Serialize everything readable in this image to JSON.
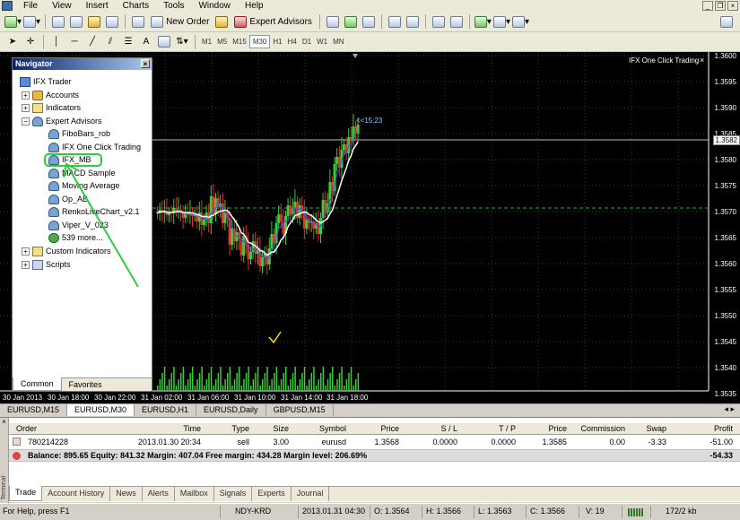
{
  "menu": {
    "items": [
      "File",
      "View",
      "Insert",
      "Charts",
      "Tools",
      "Window",
      "Help"
    ]
  },
  "toolbar": {
    "new_order_label": "New Order",
    "expert_advisors_label": "Expert Advisors",
    "timeframes": [
      "M1",
      "M5",
      "M15",
      "M30",
      "H1",
      "H4",
      "D1",
      "W1",
      "MN"
    ],
    "active_timeframe": "M30",
    "text_tool": "A"
  },
  "navigator": {
    "title": "Navigator",
    "root": "IFX Trader",
    "items": {
      "accounts": "Accounts",
      "indicators": "Indicators",
      "expert_advisors": "Expert Advisors",
      "custom_indicators": "Custom Indicators",
      "scripts": "Scripts"
    },
    "experts": [
      "FiboBars_rob",
      "IFX One Click Trading",
      "IFX_MB",
      "MACD Sample",
      "Moving Average",
      "Op_AB",
      "RenkoLiveChart_v2.1",
      "Viper_V_023",
      "539 more..."
    ],
    "tabs": [
      "Common",
      "Favorites"
    ]
  },
  "chart": {
    "overlay_label": "IFX One Click Trading",
    "countdown": "<<15:23",
    "current_price": "1.3582",
    "price_levels": [
      "1.3600",
      "1.3595",
      "1.3590",
      "1.3585",
      "1.3580",
      "1.3575",
      "1.3570",
      "1.3565",
      "1.3560",
      "1.3555",
      "1.3550",
      "1.3545",
      "1.3540",
      "1.3535"
    ],
    "time_labels": [
      "30 Jan 2013",
      "30 Jan 18:00",
      "30 Jan 22:00",
      "31 Jan 02:00",
      "31 Jan 06:00",
      "31 Jan 10:00",
      "31 Jan 14:00",
      "31 Jan 18:00"
    ]
  },
  "chart_tabs": [
    "EURUSD,M15",
    "EURUSD,M30",
    "EURUSD,H1",
    "EURUSD,Daily",
    "GBPUSD,M15"
  ],
  "active_chart_tab": "EURUSD,M30",
  "terminal": {
    "side_label": "Terminal",
    "columns": {
      "order": "Order",
      "time": "Time",
      "type": "Type",
      "size": "Size",
      "symbol": "Symbol",
      "price": "Price",
      "sl": "S / L",
      "tp": "T / P",
      "price2": "Price",
      "commission": "Commission",
      "swap": "Swap",
      "profit": "Profit"
    },
    "order_row": {
      "order": "780214228",
      "time": "2013.01.30 20:34",
      "type": "sell",
      "size": "3.00",
      "symbol": "eurusd",
      "price": "1.3568",
      "sl": "0.0000",
      "tp": "0.0000",
      "price2": "1.3585",
      "commission": "0.00",
      "swap": "-3.33",
      "profit": "-51.00"
    },
    "balance_text": "Balance: 895.65  Equity: 841.32  Margin: 407.04  Free margin: 434.28  Margin level: 206.69%",
    "balance_profit": "-54.33",
    "tabs": [
      "Trade",
      "Account History",
      "News",
      "Alerts",
      "Mailbox",
      "Signals",
      "Experts",
      "Journal"
    ]
  },
  "status": {
    "help": "For Help, press F1",
    "profile": "NDY-KRD",
    "datetime": "2013.01.31 04:30",
    "open": "O: 1.3564",
    "high": "H: 1.3566",
    "low": "L: 1.3563",
    "close": "C: 1.3566",
    "volume": "V: 19",
    "traffic": "172/2 kb"
  }
}
